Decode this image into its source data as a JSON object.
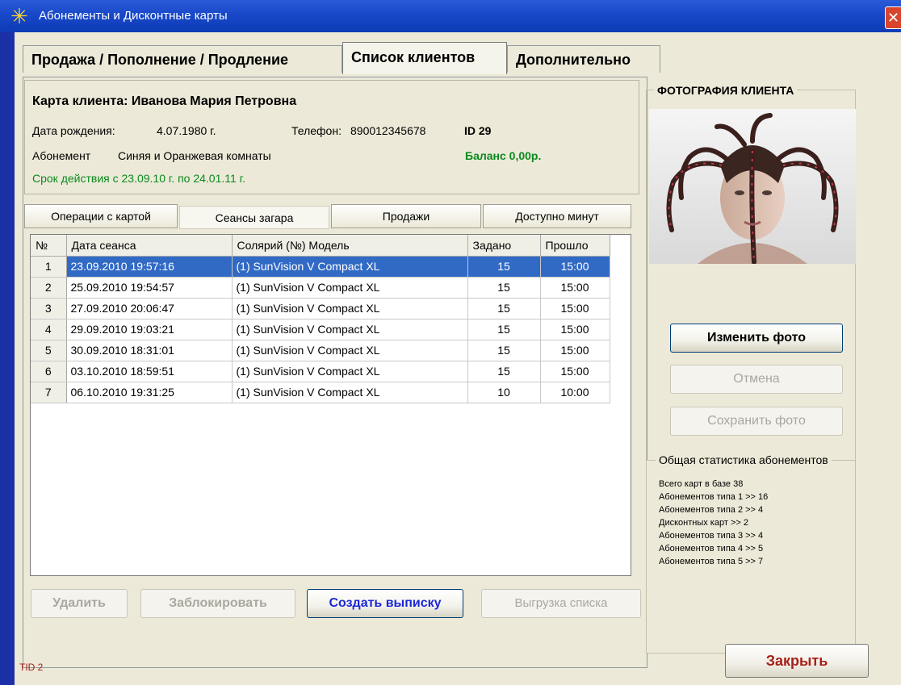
{
  "window": {
    "title": "Абонементы и Дисконтные карты",
    "close_glyph": "✕"
  },
  "tabs": [
    {
      "label": "Продажа / Пополнение / Продление"
    },
    {
      "label": "Список клиентов"
    },
    {
      "label": "Дополнительно"
    }
  ],
  "client": {
    "card_label": "Карта клиента: Иванова Мария Петровна",
    "birth_label": "Дата рождения:",
    "birth_value": "4.07.1980 г.",
    "phone_label": "Телефон:",
    "phone_value": "890012345678",
    "id": "ID 29",
    "subscription_label": "Абонемент",
    "subscription_value": "Синяя и Оранжевая комнаты",
    "balance": "Баланс  0,00р.",
    "validity": "Срок действия с 23.09.10 г. по 24.01.11 г."
  },
  "subtabs": [
    {
      "label": "Операции с картой"
    },
    {
      "label": "Сеансы загара"
    },
    {
      "label": "Продажи"
    },
    {
      "label": "Доступно минут"
    }
  ],
  "table": {
    "columns": [
      "№",
      "Дата сеанса",
      "Солярий (№) Модель",
      "Задано",
      "Прошло"
    ],
    "rows": [
      {
        "n": "1",
        "date": "23.09.2010 19:57:16",
        "model": "(1) SunVision V Compact XL",
        "set": "15",
        "passed": "15:00"
      },
      {
        "n": "2",
        "date": "25.09.2010 19:54:57",
        "model": "(1) SunVision V Compact XL",
        "set": "15",
        "passed": "15:00"
      },
      {
        "n": "3",
        "date": "27.09.2010 20:06:47",
        "model": "(1) SunVision V Compact XL",
        "set": "15",
        "passed": "15:00"
      },
      {
        "n": "4",
        "date": "29.09.2010 19:03:21",
        "model": "(1) SunVision V Compact XL",
        "set": "15",
        "passed": "15:00"
      },
      {
        "n": "5",
        "date": "30.09.2010 18:31:01",
        "model": "(1) SunVision V Compact XL",
        "set": "15",
        "passed": "15:00"
      },
      {
        "n": "6",
        "date": "03.10.2010 18:59:51",
        "model": "(1) SunVision V Compact XL",
        "set": "15",
        "passed": "15:00"
      },
      {
        "n": "7",
        "date": "06.10.2010 19:31:25",
        "model": "(1) SunVision V Compact XL",
        "set": "10",
        "passed": "10:00"
      }
    ]
  },
  "actions": {
    "delete": "Удалить",
    "block": "Заблокировать",
    "statement": "Создать выписку",
    "export": "Выгрузка списка"
  },
  "photo": {
    "legend": "ФОТОГРАФИЯ КЛИЕНТА",
    "change": "Изменить фото",
    "cancel": "Отмена",
    "save": "Сохранить фото"
  },
  "stats": {
    "legend": "Общая статистика абонементов",
    "lines": [
      "Всего карт в базе 38",
      "Абонементов  типа 1  >> 16",
      "Абонементов  типа 2  >> 4",
      "Дисконтных карт     >> 2",
      "Абонементов  типа 3  >> 4",
      "Абонементов  типа 4  >> 5",
      "Абонементов  типа 5  >> 7"
    ]
  },
  "footer": {
    "close": "Закрыть",
    "tid": "TID 2"
  },
  "colors": {
    "selection": "#316ac5",
    "balance_green": "#0a8a1e",
    "close_red": "#a6201a",
    "statement_blue": "#1b27d8"
  }
}
